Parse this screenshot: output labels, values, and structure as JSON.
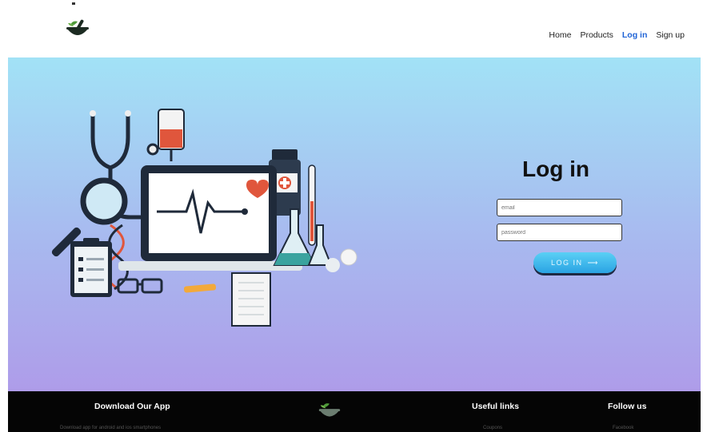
{
  "nav": {
    "items": [
      {
        "label": "Home"
      },
      {
        "label": "Products"
      },
      {
        "label": "Log in"
      },
      {
        "label": "Sign up"
      }
    ]
  },
  "login": {
    "title": "Log in",
    "email_placeholder": "email",
    "password_placeholder": "password",
    "button_label": "LOG IN",
    "button_arrow": "⟶"
  },
  "footer": {
    "download_title": "Download Our App",
    "download_text": "Download app for android and ios smartphones",
    "links_title": "Useful links",
    "links_first": "Coupons",
    "follow_title": "Follow us",
    "follow_first": "Facebook"
  },
  "colors": {
    "accent": "#1f63d6",
    "hero_top": "#a2e2f6",
    "hero_bottom": "#ae9ce9",
    "button": "#2aa3e3",
    "footer": "#050505"
  }
}
